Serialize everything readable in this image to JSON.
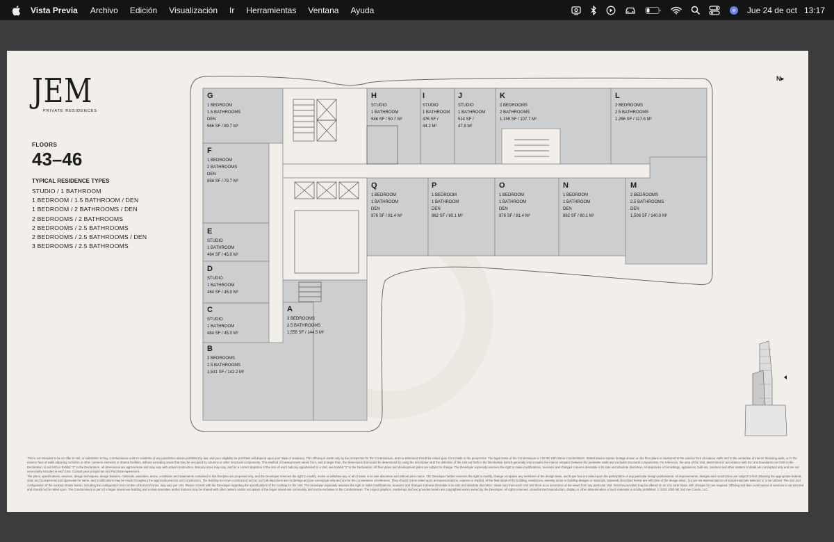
{
  "menubar": {
    "app_name": "Vista Previa",
    "items": [
      "Archivo",
      "Edición",
      "Visualización",
      "Ir",
      "Herramientas",
      "Ventana",
      "Ayuda"
    ],
    "date": "Jue 24 de oct",
    "time": "13:17",
    "status_icons": [
      "screen-mirror-icon",
      "bluetooth-icon",
      "play-icon",
      "car-icon",
      "battery-icon",
      "wifi-icon",
      "spotlight-search-icon",
      "control-center-icon",
      "siri-icon"
    ]
  },
  "document": {
    "brand_logo": "JEM",
    "brand_sub": "PRIVATE RESIDENCES",
    "floors_label": "FLOORS",
    "floors_value": "43–46",
    "types_title": "TYPICAL RESIDENCE TYPES",
    "types": [
      "STUDIO / 1 BATHROOM",
      "1 BEDROOM / 1.5 BATHROOM / DEN",
      "1 BEDROOM / 2 BATHROOMS / DEN",
      "2 BEDROOMS / 2 BATHROOMS",
      "2 BEDROOMS / 2.5 BATHROOMS",
      "2 BEDROOMS / 2.5 BATHROOMS / DEN",
      "3 BEDROOMS / 2.5 BATHROOMS"
    ],
    "north_label": "N",
    "units": [
      {
        "code": "G",
        "lines": [
          "1 BEDROOM",
          "1.5 BATHROOMS",
          "DEN",
          "966 SF / 89.7 M²"
        ]
      },
      {
        "code": "H",
        "lines": [
          "STUDIO",
          "1 BATHROOM",
          "546 SF / 50.7 M²"
        ]
      },
      {
        "code": "I",
        "lines": [
          "STUDIO",
          "1 BATHROOM",
          "476 SF /",
          "44.2 M²"
        ]
      },
      {
        "code": "J",
        "lines": [
          "STUDIO",
          "1 BATHROOM",
          "514 SF /",
          "47.8 M²"
        ]
      },
      {
        "code": "K",
        "lines": [
          "2 BEDROOMS",
          "2 BATHROOMS",
          "1,159 SF / 107.7 M²"
        ]
      },
      {
        "code": "L",
        "lines": [
          "2 BEDROOMS",
          "2.5 BATHROOMS",
          "1,266 SF / 117.6 M²"
        ]
      },
      {
        "code": "F",
        "lines": [
          "1 BEDROOM",
          "2 BATHROOMS",
          "DEN",
          "858 SF / 79.7 M²"
        ]
      },
      {
        "code": "Q",
        "lines": [
          "1 BEDROOM",
          "1 BATHROOM",
          "DEN",
          "876 SF / 81.4 M²"
        ]
      },
      {
        "code": "P",
        "lines": [
          "1 BEDROOM",
          "1 BATHROOM",
          "DEN",
          "862 SF / 80.1 M²"
        ]
      },
      {
        "code": "O",
        "lines": [
          "1 BEDROOM",
          "1 BATHROOM",
          "DEN",
          "876 SF / 81.4 M²"
        ]
      },
      {
        "code": "N",
        "lines": [
          "1 BEDROOM",
          "1 BATHROOM",
          "DEN",
          "862 SF / 80.1 M²"
        ]
      },
      {
        "code": "M",
        "lines": [
          "2 BEDROOMS",
          "2.5 BATHROOMS",
          "DEN",
          "1,506 SF / 140.0 M²"
        ]
      },
      {
        "code": "E",
        "lines": [
          "STUDIO",
          "1 BATHROOM",
          "484 SF / 45.0 M²"
        ]
      },
      {
        "code": "D",
        "lines": [
          "STUDIO",
          "1 BATHROOM",
          "484 SF / 45.0 M²"
        ]
      },
      {
        "code": "C",
        "lines": [
          "STUDIO",
          "1 BATHROOM",
          "484 SF / 45.0 M²"
        ]
      },
      {
        "code": "A",
        "lines": [
          "3 BEDROOMS",
          "2.5 BATHROOMS",
          "1,555 SF / 144.5 M²"
        ]
      },
      {
        "code": "B",
        "lines": [
          "3 BEDROOMS",
          "2.5 BATHROOMS",
          "1,531 SF / 142.2 M²"
        ]
      }
    ],
    "disclaimer": [
      "This is not intended to be an offer to sell, or solicitation to buy, Condominium Units to residents of any jurisdiction where prohibited by law, and your eligibility for purchase will depend upon your state of residency. This offering is made only by the prospectus for the Condominium, and no statement should be relied upon if not made in the prospectus. The legal name of the Condominium is 175 NE 10th Street Condominium. Stated interior square footage shown on the floor plans is measured to the exterior face of exterior walls and to the centerline of interior demising walls, or to the exterior face of walls adjoining corridors or other common elements or shared facilities, without excluding areas that may be occupied by columns or other structural components. This method of measurement varies from, and is larger than, the dimensions that would be determined by using the description and the definition of the Unit set forth in the Declaration (which generally only includes the interior airspace between the perimeter walls and excludes structural components). For reference, the area of the Unit, determined in accordance with the Unit boundaries set forth in the Declaration, is set forth in Exhibit \"3\" to the Declaration. All dimensions are approximate and may vary with actual construction. Balcony sizes may vary, and for a correct depiction of the size of each balcony appurtenant to a Unit, see Exhibit \"2\" to the Declaration. All floor plans and development plans are subject to change. The Developer expressly reserves the right to make modifications, revisions and changes it deems desirable in its sole and absolute discretion. All depictions of furnishings, appliances, built-ins, counters and other matters of detail are conceptual only and are not necessarily included in each Unit. Consult your prospectus and Purchase Agreement.",
      "The plans, specifications, services, design techniques, design features, materials, amenities, terms, conditions and statements contained in this floorplan are proposed only, and the Developer reserves the right to modify, revise or withdraw any or all of same in its sole discretion and without prior notice. The Developer further reserves the right to modify, change or replace any members of the design team, and buyer has not relied upon the participation of any particular design professional. All improvements, designs and construction are subject to first obtaining the appropriate federal, state and local permits and approvals for same, and modifications may be made throughout the approvals process and construction. The building is not yet constructed and as such all depictions are renderings and are conceptual only and are for the convenience of reference. They should not be relied upon as representations, express or implied, of the final detail of the building, residences, amenity areas or building designs or materials. Materials described herein are reflective of the design vision, but are not representations of actual materials selected or to be utilized. The size and configuration of the cooktop shown herein, including the configuration and number of burners/zones, may vary per Unit. Please consult with the Developer regarding the specifications of the cooktop for the Unit. The Developer expressly reserves the right to make modifications, revisions and changes it deems desirable in its sole and absolute discretion. Views vary from each Unit and there is no assurance of the views from any particular Unit. Services provided may be offered on an a la carte basis, with charges for use required. Offering and then continuation of services is not assured and should not be relied upon. The Condominium is part of a larger mixed-use building and certain amenities and/or features may be shared with other owners and/or occupants of the larger mixed-use community and not be exclusive to the Condominium. The project graphics, renderings and text provided herein are copyrighted works owned by the Developer. All rights reserved. Unauthorized reproduction, display or other dissemination of such materials is strictly prohibited. © 2023 1000 NE 2nd Ave Condo, LLC."
    ]
  }
}
